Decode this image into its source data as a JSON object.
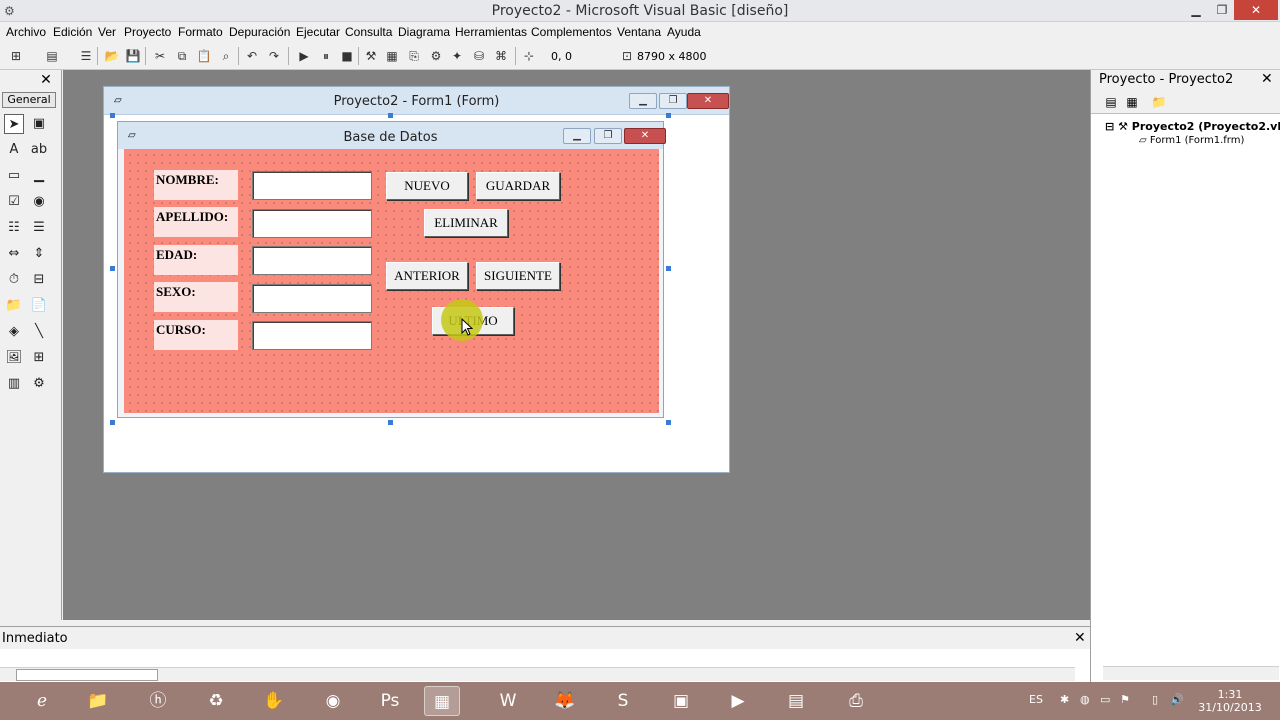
{
  "window": {
    "title": "Proyecto2 - Microsoft Visual Basic [diseño]",
    "minimize": "▁",
    "restore": "❐",
    "close": "✕"
  },
  "menu": [
    "Archivo",
    "Edición",
    "Ver",
    "Proyecto",
    "Formato",
    "Depuración",
    "Ejecutar",
    "Consulta",
    "Diagrama",
    "Herramientas",
    "Complementos",
    "Ventana",
    "Ayuda"
  ],
  "toolbar": {
    "position": "0, 0",
    "size": "8790 x 4800"
  },
  "toolbox": {
    "tab": "General",
    "close": "✕"
  },
  "designer": {
    "title": "Proyecto2 - Form1 (Form)"
  },
  "form": {
    "title": "Base de Datos",
    "labels": {
      "nombre": "NOMBRE:",
      "apellido": "APELLIDO:",
      "edad": "EDAD:",
      "sexo": "SEXO:",
      "curso": "CURSO:"
    },
    "buttons": {
      "nuevo": "NUEVO",
      "guardar": "GUARDAR",
      "eliminar": "ELIMINAR",
      "anterior": "ANTERIOR",
      "siguiente": "SIGUIENTE",
      "ultimo": "ULTIMO"
    }
  },
  "project": {
    "title": "Proyecto - Proyecto2",
    "close": "✕",
    "root": "Proyecto2 (Proyecto2.vbp)",
    "child": "Form1 (Form1.frm)"
  },
  "immediate": {
    "title": "Inmediato",
    "close": "✕"
  },
  "taskbar": {
    "lang": "ES",
    "time": "1:31",
    "date": "31/10/2013"
  },
  "colors": {
    "form_back": "#f98a7c",
    "taskbar": "#9b7d75",
    "workspace": "#808080"
  }
}
